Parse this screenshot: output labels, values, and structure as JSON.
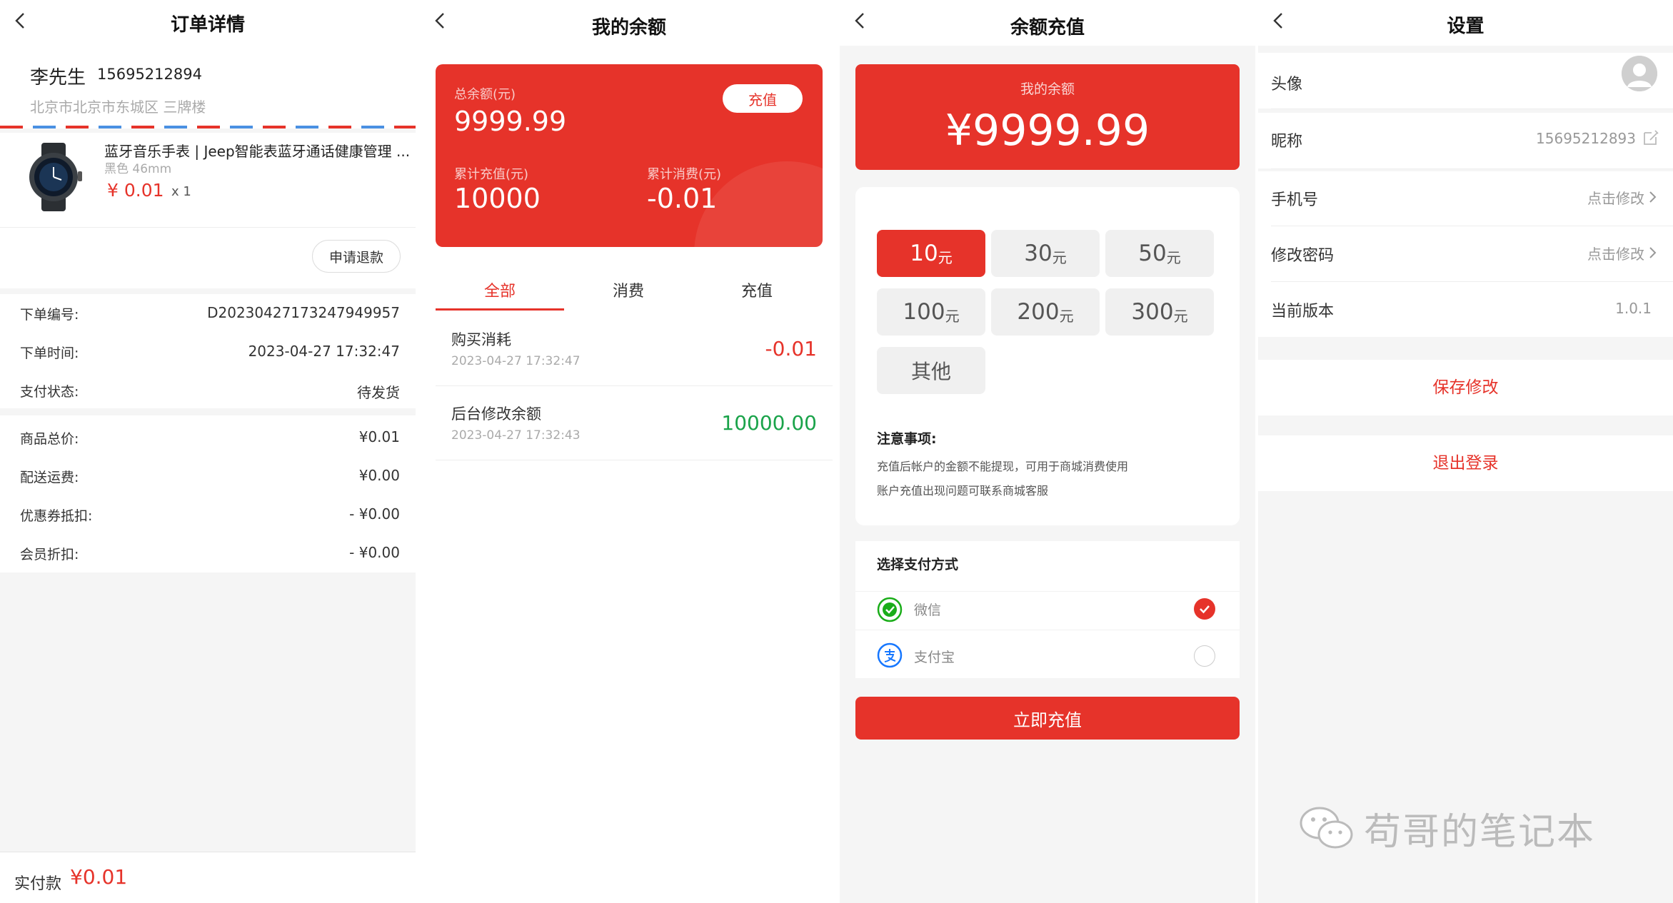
{
  "colors": {
    "accent": "#e6332a",
    "success": "#1aa34a",
    "wechat": "#1aad19",
    "alipay": "#1677ff"
  },
  "order": {
    "title": "订单详情",
    "name": "李先生",
    "phone": "15695212894",
    "address": "北京市北京市东城区 三牌楼",
    "product": {
      "name": "蓝牙音乐手表 | Jeep智能表蓝牙通话健康管理 ...",
      "spec": "黑色 46mm",
      "price": "¥ 0.01",
      "qty": "x 1"
    },
    "refund_label": "申请退款",
    "info": [
      {
        "label": "下单编号:",
        "value": "D20230427173247949957"
      },
      {
        "label": "下单时间:",
        "value": "2023-04-27 17:32:47"
      },
      {
        "label": "支付状态:",
        "value": "待发货"
      }
    ],
    "costs": [
      {
        "label": "商品总价:",
        "value": "¥0.01"
      },
      {
        "label": "配送运费:",
        "value": "¥0.00"
      },
      {
        "label": "优惠券抵扣:",
        "value": "- ¥0.00"
      },
      {
        "label": "会员折扣:",
        "value": "- ¥0.00"
      }
    ],
    "paid_label": "实付款",
    "paid_value": "¥0.01"
  },
  "balance": {
    "title": "我的余额",
    "total_label": "总余额(元)",
    "total_value": "9999.99",
    "recharge_btn": "充值",
    "recharged_label": "累计充值(元)",
    "recharged_value": "10000",
    "consumed_label": "累计消费(元)",
    "consumed_value": "-0.01",
    "tabs": [
      "全部",
      "消费",
      "充值"
    ],
    "records": [
      {
        "title": "购买消耗",
        "time": "2023-04-27 17:32:47",
        "amount": "-0.01"
      },
      {
        "title": "后台修改余额",
        "time": "2023-04-27 17:32:43",
        "amount": "10000.00"
      }
    ]
  },
  "recharge": {
    "title": "余额充值",
    "balance_label": "我的余额",
    "balance_value": "¥9999.99",
    "amounts": [
      {
        "num": "10",
        "unit": "元"
      },
      {
        "num": "30",
        "unit": "元"
      },
      {
        "num": "50",
        "unit": "元"
      },
      {
        "num": "100",
        "unit": "元"
      },
      {
        "num": "200",
        "unit": "元"
      },
      {
        "num": "300",
        "unit": "元"
      },
      {
        "num": "其他",
        "unit": ""
      }
    ],
    "notes_title": "注意事项:",
    "notes": [
      "充值后帐户的金额不能提现，可用于商城消费使用",
      "账户充值出现问题可联系商城客服"
    ],
    "pay_title": "选择支付方式",
    "pay_methods": [
      {
        "label": "微信",
        "icon": "wechat-pay-icon",
        "selected": true
      },
      {
        "label": "支付宝",
        "icon": "alipay-icon",
        "selected": false
      }
    ],
    "submit": "立即充值"
  },
  "settings": {
    "title": "设置",
    "rows": [
      {
        "label": "头像",
        "value": ""
      },
      {
        "label": "昵称",
        "value": "15695212893"
      },
      {
        "label": "手机号",
        "value": "点击修改"
      },
      {
        "label": "修改密码",
        "value": "点击修改"
      },
      {
        "label": "当前版本",
        "value": "1.0.1"
      }
    ],
    "save": "保存修改",
    "logout": "退出登录"
  },
  "watermark": "苟哥的笔记本"
}
